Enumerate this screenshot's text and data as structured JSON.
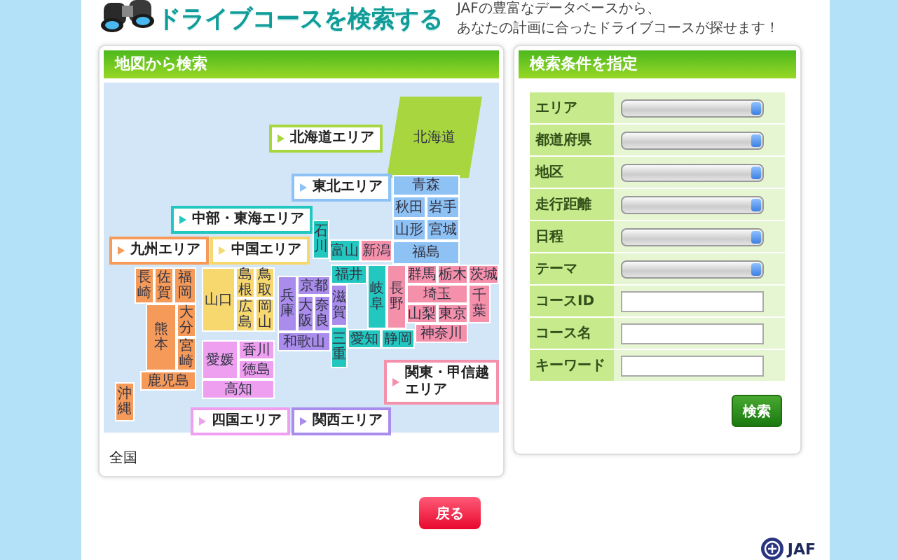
{
  "header": {
    "title": "ドライブコースを検索する",
    "description": [
      "JAFの豊富なデータベースから、",
      "あなたの計画に合ったドライブコースが探せます！"
    ]
  },
  "map_panel": {
    "title": "地図から検索",
    "areas": [
      {
        "label": "北海道エリア",
        "color": "#a8d63f",
        "prefectures": [
          "北海道"
        ]
      },
      {
        "label": "東北エリア",
        "color": "#8ec2f4",
        "prefectures": [
          "青森",
          "秋田",
          "岩手",
          "山形",
          "宮城",
          "福島"
        ]
      },
      {
        "label": "中部・東海エリア",
        "color": "#22c8c0",
        "prefectures": [
          "石川",
          "富山",
          "福井",
          "岐阜",
          "三重",
          "愛知",
          "静岡"
        ]
      },
      {
        "label": "九州エリア",
        "color": "#f59a58",
        "prefectures": [
          "長崎",
          "佐賀",
          "福岡",
          "大分",
          "熊本",
          "宮崎",
          "鹿児島",
          "沖縄"
        ]
      },
      {
        "label": "中国エリア",
        "color": "#f7d86e",
        "prefectures": [
          "山口",
          "島根",
          "広島",
          "鳥取",
          "岡山"
        ]
      },
      {
        "label": "関東・甲信越エリア",
        "color": "#f590ab",
        "prefectures": [
          "新潟",
          "長野",
          "群馬",
          "栃木",
          "茨城",
          "埼玉",
          "山梨",
          "東京",
          "千葉",
          "神奈川"
        ]
      },
      {
        "label": "四国エリア",
        "color": "#ee9ff0",
        "prefectures": [
          "愛媛",
          "香川",
          "徳島",
          "高知"
        ]
      },
      {
        "label": "関西エリア",
        "color": "#a98ceb",
        "prefectures": [
          "兵庫",
          "京都",
          "滋賀",
          "大阪",
          "奈良",
          "和歌山"
        ]
      }
    ],
    "footer_link": "全国"
  },
  "search_panel": {
    "title": "検索条件を指定",
    "fields": [
      {
        "label": "エリア",
        "kind": "select"
      },
      {
        "label": "都道府県",
        "kind": "select"
      },
      {
        "label": "地区",
        "kind": "select"
      },
      {
        "label": "走行距離",
        "kind": "select"
      },
      {
        "label": "日程",
        "kind": "select"
      },
      {
        "label": "テーマ",
        "kind": "select"
      },
      {
        "label": "コースID",
        "kind": "text"
      },
      {
        "label": "コース名",
        "kind": "text"
      },
      {
        "label": "キーワード",
        "kind": "text"
      }
    ],
    "button": "検索"
  },
  "back_button": "戻る",
  "logo": {
    "text": "JAF"
  }
}
